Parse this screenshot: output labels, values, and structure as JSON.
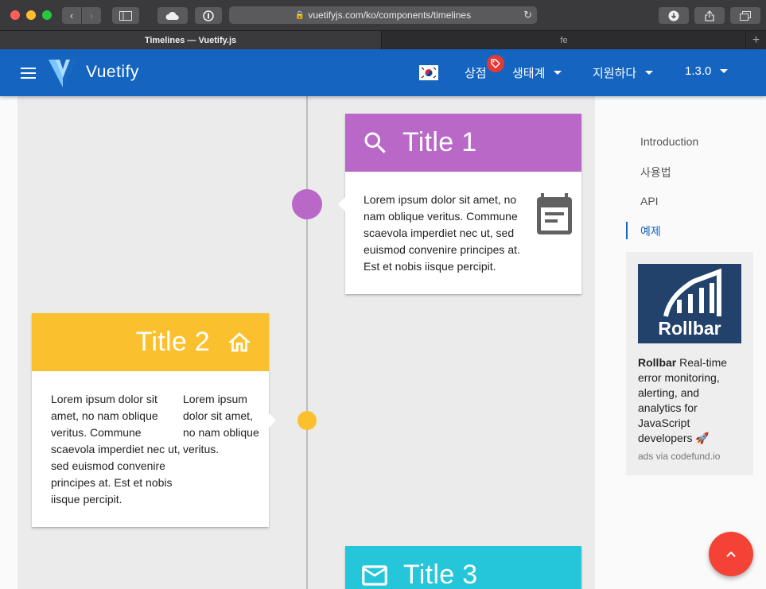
{
  "browser": {
    "url": "vuetifyjs.com/ko/components/timelines",
    "tabs": [
      {
        "label": "Timelines — Vuetify.js"
      },
      {
        "label": "fe"
      }
    ]
  },
  "appbar": {
    "brand": "Vuetify",
    "store_label": "상점",
    "ecosystem_label": "생태계",
    "support_label": "지원하다",
    "version_label": "1.3.0"
  },
  "timeline": {
    "cards": [
      {
        "title": "Title 1",
        "color": "#ba68c8",
        "icon": "magnify-icon",
        "body": "Lorem ipsum dolor sit amet, no nam oblique veritus. Commune scaevola imperdiet nec ut, sed euismod convenire principes at. Est et nobis iisque percipit.",
        "side_icon": "calendar-icon"
      },
      {
        "title": "Title 2",
        "color": "#fbc02d",
        "icon": "home-icon",
        "body": "Lorem ipsum dolor sit amet, no nam oblique veritus. Commune scaevola imperdiet nec ut, sed euismod convenire principes at. Est et nobis iisque percipit.",
        "body2": "Lorem ipsum dolor sit amet, no nam oblique veritus."
      },
      {
        "title": "Title 3",
        "color": "#26c6da",
        "icon": "email-icon"
      }
    ]
  },
  "toc": {
    "items": [
      {
        "label": "Introduction"
      },
      {
        "label": "사용법"
      },
      {
        "label": "API"
      },
      {
        "label": "예제"
      }
    ],
    "active_color": "#1565c0"
  },
  "ad": {
    "logo_text": "Rollbar",
    "headline": "Rollbar",
    "text": " Real-time error monitoring, alerting, and analytics for JavaScript developers 🚀",
    "via": "ads via codefund.io"
  },
  "colors": {
    "primary": "#1565c0",
    "fab": "#f44336"
  }
}
